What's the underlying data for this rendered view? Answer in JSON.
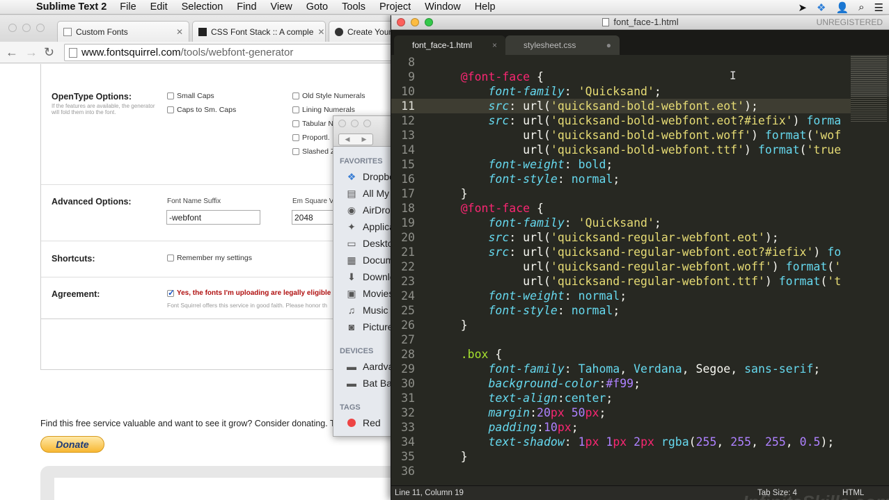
{
  "menubar": {
    "app_name": "Sublime Text 2",
    "items": [
      "File",
      "Edit",
      "Selection",
      "Find",
      "View",
      "Goto",
      "Tools",
      "Project",
      "Window",
      "Help"
    ]
  },
  "browser": {
    "tabs": [
      {
        "title": "Custom Fonts",
        "icon": "page-icon"
      },
      {
        "title": "CSS Font Stack :: A comple",
        "icon": "css-stack-icon"
      },
      {
        "title": "Create Your",
        "icon": "fontsquirrel-icon"
      }
    ],
    "url_host": "www.fontsquirrel.com",
    "url_path": "/tools/webfont-generator",
    "form": {
      "opentype_label": "OpenType Options:",
      "opentype_note": "If the features are available, the generator will fold them into the font.",
      "opentype_checks_col1": [
        "Small Caps",
        "Caps to Sm. Caps"
      ],
      "opentype_checks_col2": [
        "Old Style Numerals",
        "Lining Numerals",
        "Tabular N",
        "Proportl.",
        "Slashed Z"
      ],
      "advanced_label": "Advanced Options:",
      "suffix_label": "Font Name Suffix",
      "suffix_value": "-webfont",
      "em_label": "Em Square V",
      "em_value": "2048",
      "shortcuts_label": "Shortcuts:",
      "remember_label": "Remember my settings",
      "agreement_label": "Agreement:",
      "agreement_text": "Yes, the fonts I'm uploading are legally eligible",
      "agreement_note": "Font Squirrel offers this service in good faith. Please honor th"
    },
    "donate_text": "Find this free service valuable and want to see it grow? Consider donating. Tha",
    "donate_button": "Donate"
  },
  "finder": {
    "favorites_label": "FAVORITES",
    "favorites": [
      {
        "label": "Dropbo",
        "icon": "dropbox-icon"
      },
      {
        "label": "All My",
        "icon": "all-files-icon"
      },
      {
        "label": "AirDro",
        "icon": "airdrop-icon"
      },
      {
        "label": "Applica",
        "icon": "applications-icon"
      },
      {
        "label": "Deskto",
        "icon": "desktop-icon"
      },
      {
        "label": "Docum",
        "icon": "documents-icon"
      },
      {
        "label": "Downlo",
        "icon": "downloads-icon"
      },
      {
        "label": "Movies",
        "icon": "movies-icon"
      },
      {
        "label": "Music",
        "icon": "music-icon"
      },
      {
        "label": "Picture",
        "icon": "pictures-icon"
      }
    ],
    "devices_label": "DEVICES",
    "devices": [
      {
        "label": "Aardva",
        "icon": "disk-icon"
      },
      {
        "label": "Bat Bac",
        "icon": "disk-icon"
      }
    ],
    "tags_label": "TAGS",
    "tags": [
      {
        "label": "Red",
        "color": "#ee4444"
      }
    ]
  },
  "sublime": {
    "window_title": "font_face-1.html",
    "unregistered": "UNREGISTERED",
    "tabs": [
      {
        "label": "font_face-1.html",
        "active": true,
        "marker": "×"
      },
      {
        "label": "stylesheet.css",
        "active": false,
        "marker": "●"
      }
    ],
    "line_numbers": [
      "8",
      "9",
      "10",
      "11",
      "12",
      "13",
      "14",
      "15",
      "16",
      "17",
      "18",
      "19",
      "20",
      "21",
      "22",
      "23",
      "24",
      "25",
      "26",
      "27",
      "28",
      "29",
      "30",
      "31",
      "32",
      "33",
      "34",
      "35",
      "36"
    ],
    "current_line": "11",
    "status_position": "Line 11, Column 19",
    "status_tab_size": "Tab Size: 4",
    "status_syntax": "HTML",
    "watermark": "InfiniteSkills.com"
  },
  "colors": {
    "editor_bg": "#272822",
    "keyword_pink": "#f92672",
    "property_blue": "#66d9ef",
    "string_yellow": "#e6db74",
    "number_purple": "#ae81ff",
    "class_green": "#a6e22e"
  }
}
